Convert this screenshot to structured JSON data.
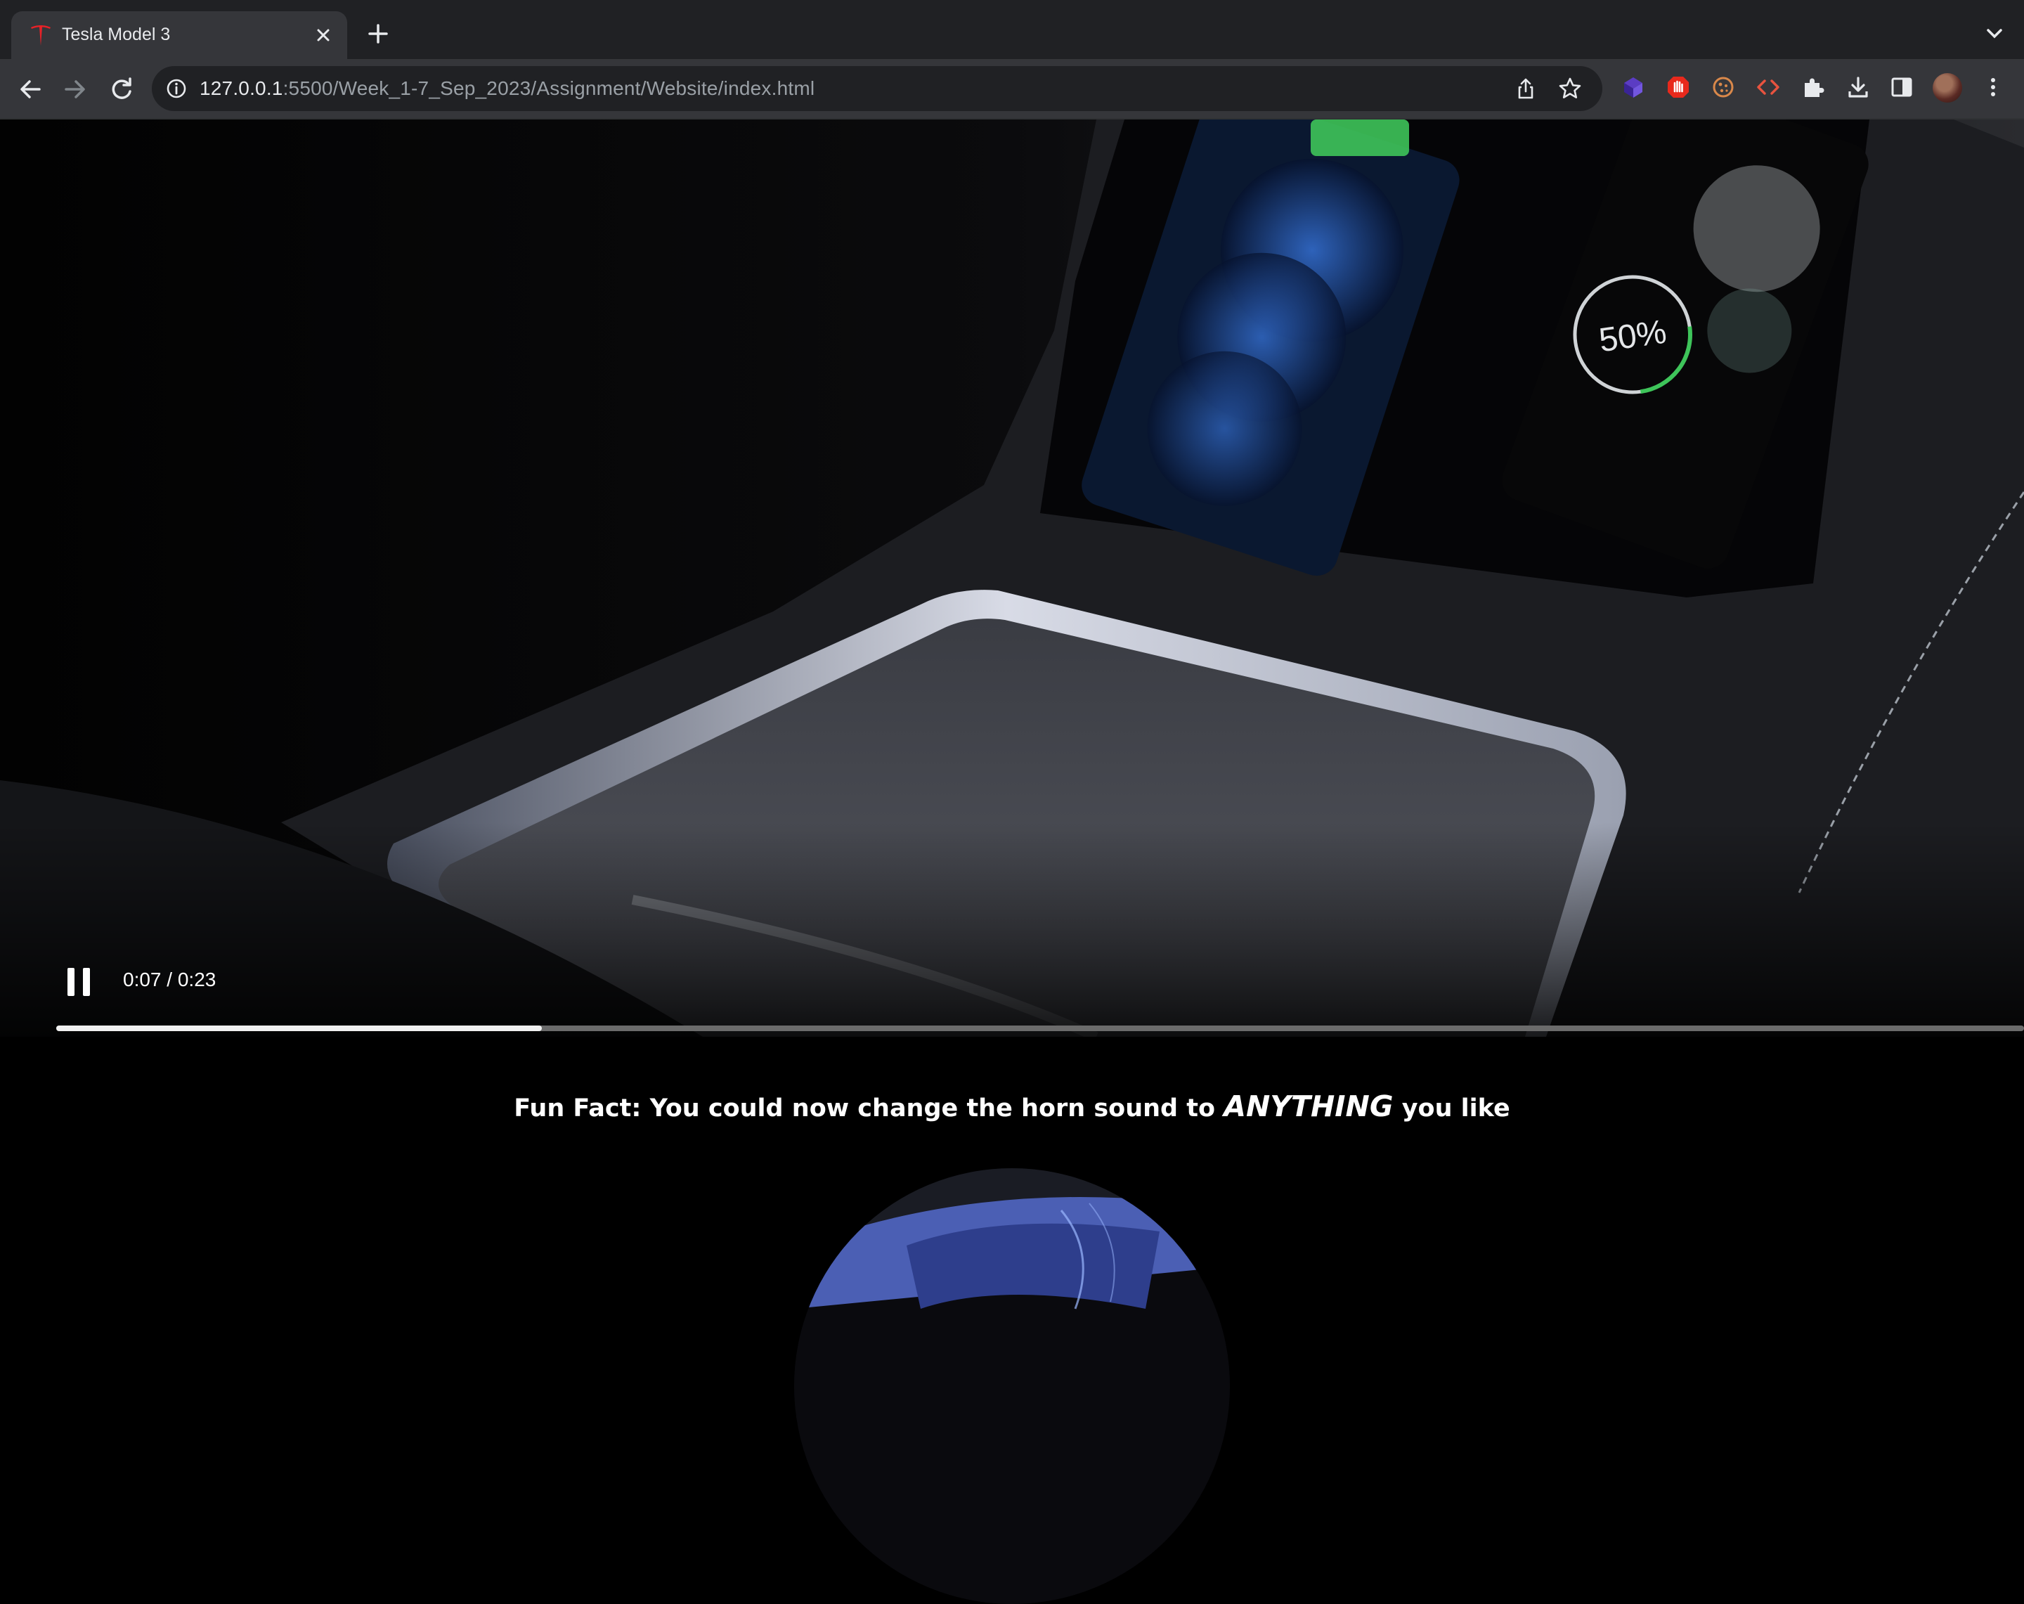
{
  "browser": {
    "tab_title": "Tesla Model 3",
    "url_host": "127.0.0.1",
    "url_path": ":5500/Week_1-7_Sep_2023/Assignment/Website/index.html"
  },
  "video": {
    "current_time": "0:07",
    "duration": "0:23",
    "progress_fraction": 0.2467,
    "screen_badge": "50%"
  },
  "funfact": {
    "prefix": "Fun Fact: You could now change the horn sound to",
    "emphasis": "ANYTHING",
    "suffix": "you like"
  },
  "colors": {
    "tesla_red": "#e82127",
    "charge_green": "#3ec45a"
  }
}
